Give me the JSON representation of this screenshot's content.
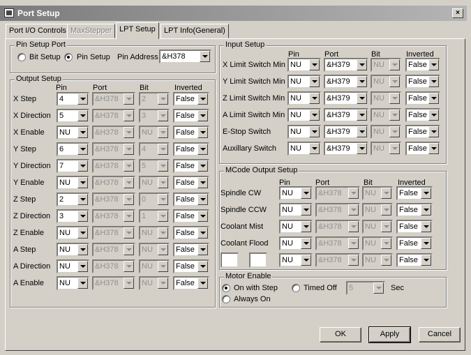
{
  "window": {
    "title": "Port Setup",
    "close_glyph": "×"
  },
  "tabs": [
    "Port I/O Controls",
    "MaxStepper",
    "LPT Setup",
    "LPT Info(General)"
  ],
  "pin_setup_port": {
    "title": "Pin Setup Port",
    "bit_setup": "Bit Setup",
    "pin_setup": "Pin Setup",
    "pin_setup_selected": true,
    "pin_address_label": "Pin Address",
    "pin_address": "&H378"
  },
  "columns": {
    "pin": "Pin",
    "port": "Port",
    "bit": "Bit",
    "inverted": "Inverted"
  },
  "output_setup": {
    "title": "Output Setup",
    "rows": [
      {
        "label": "X Step",
        "pin": "4",
        "port": "&H378",
        "bit": "2",
        "inverted": "False"
      },
      {
        "label": "X Direction",
        "pin": "5",
        "port": "&H378",
        "bit": "3",
        "inverted": "False"
      },
      {
        "label": "X Enable",
        "pin": "NU",
        "port": "&H378",
        "bit": "NU",
        "inverted": "False"
      },
      {
        "label": "Y Step",
        "pin": "6",
        "port": "&H378",
        "bit": "4",
        "inverted": "False"
      },
      {
        "label": "Y Direction",
        "pin": "7",
        "port": "&H378",
        "bit": "5",
        "inverted": "False"
      },
      {
        "label": "Y Enable",
        "pin": "NU",
        "port": "&H378",
        "bit": "NU",
        "inverted": "False"
      },
      {
        "label": "Z Step",
        "pin": "2",
        "port": "&H378",
        "bit": "0",
        "inverted": "False"
      },
      {
        "label": "Z Direction",
        "pin": "3",
        "port": "&H378",
        "bit": "1",
        "inverted": "False"
      },
      {
        "label": "Z Enable",
        "pin": "NU",
        "port": "&H378",
        "bit": "NU",
        "inverted": "False"
      },
      {
        "label": "A Step",
        "pin": "NU",
        "port": "&H378",
        "bit": "NU",
        "inverted": "False"
      },
      {
        "label": "A Direction",
        "pin": "NU",
        "port": "&H378",
        "bit": "NU",
        "inverted": "False"
      },
      {
        "label": "A Enable",
        "pin": "NU",
        "port": "&H378",
        "bit": "NU",
        "inverted": "False"
      }
    ]
  },
  "input_setup": {
    "title": "Input Setup",
    "rows": [
      {
        "label": "X Limit Switch Min",
        "pin": "NU",
        "port": "&H379",
        "bit": "NU",
        "inverted": "False"
      },
      {
        "label": "Y Limit Switch Min",
        "pin": "NU",
        "port": "&H379",
        "bit": "NU",
        "inverted": "False"
      },
      {
        "label": "Z Limit Switch Min",
        "pin": "NU",
        "port": "&H379",
        "bit": "NU",
        "inverted": "False"
      },
      {
        "label": "A Limit Switch Min",
        "pin": "NU",
        "port": "&H379",
        "bit": "NU",
        "inverted": "False"
      },
      {
        "label": "E-Stop Switch",
        "pin": "NU",
        "port": "&H379",
        "bit": "NU",
        "inverted": "False"
      },
      {
        "label": "Auxillary Switch",
        "pin": "NU",
        "port": "&H379",
        "bit": "NU",
        "inverted": "False"
      }
    ]
  },
  "mcode_output_setup": {
    "title": "MCode Output Setup",
    "rows": [
      {
        "label": "Spindle CW",
        "pin": "NU",
        "port": "&H378",
        "bit": "NU",
        "inverted": "False"
      },
      {
        "label": "Spindle CCW",
        "pin": "NU",
        "port": "&H378",
        "bit": "NU",
        "inverted": "False"
      },
      {
        "label": "Coolant Mist",
        "pin": "NU",
        "port": "&H378",
        "bit": "NU",
        "inverted": "False"
      },
      {
        "label": "Coolant Flood",
        "pin": "NU",
        "port": "&H378",
        "bit": "NU",
        "inverted": "False"
      },
      {
        "label": "",
        "pin": "NU",
        "port": "&H378",
        "bit": "NU",
        "inverted": "False"
      }
    ]
  },
  "motor_enable": {
    "title": "Motor Enable",
    "on_with_step": "On with Step",
    "timed_off": "Timed Off",
    "always_on": "Always On",
    "selected": "on_with_step",
    "timed_value": "5",
    "sec_label": "Sec"
  },
  "buttons": {
    "ok": "OK",
    "apply": "Apply",
    "cancel": "Cancel"
  }
}
